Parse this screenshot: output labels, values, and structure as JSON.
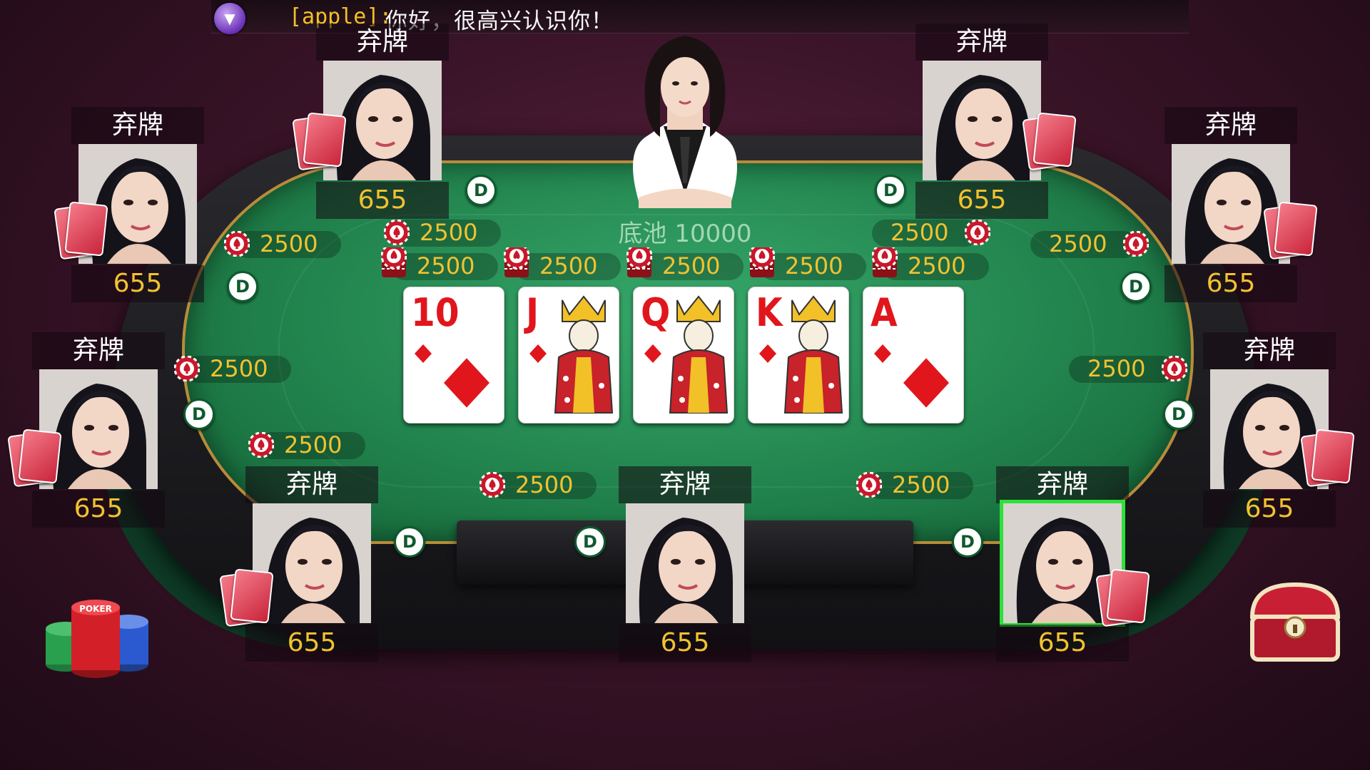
{
  "chat": {
    "sender": "[apple]:",
    "message": "你好，很高兴认识你！",
    "toggle_icon": "▼"
  },
  "pot": {
    "label": "底池 10000"
  },
  "community_cards": [
    {
      "rank": "10",
      "suit": "diamonds"
    },
    {
      "rank": "J",
      "suit": "diamonds"
    },
    {
      "rank": "Q",
      "suit": "diamonds"
    },
    {
      "rank": "K",
      "suit": "diamonds"
    },
    {
      "rank": "A",
      "suit": "diamonds"
    }
  ],
  "seats": [
    {
      "status": "弃牌",
      "chips": "655",
      "bet": "2500"
    },
    {
      "status": "弃牌",
      "chips": "655",
      "bet": "2500"
    },
    {
      "status": "弃牌",
      "chips": "655",
      "bet": "2500"
    },
    {
      "status": "弃牌",
      "chips": "655",
      "bet": "2500"
    },
    {
      "status": "弃牌",
      "chips": "655",
      "bet": "2500"
    },
    {
      "status": "弃牌",
      "chips": "655",
      "bet": "2500"
    },
    {
      "status": "弃牌",
      "chips": "655",
      "bet": "2500"
    },
    {
      "status": "弃牌",
      "chips": "655",
      "bet": "2500"
    },
    {
      "status": "弃牌",
      "chips": "655",
      "bet": "2500"
    }
  ],
  "center_bets": [
    "2500",
    "2500",
    "2500",
    "2500",
    "2500"
  ],
  "dealer_button_label": "D",
  "chip_stack_label": "POKER",
  "colors": {
    "felt": "#258a52",
    "chip_text": "#f2c230",
    "card_red": "#e0161c",
    "active_outline": "#2ee03a"
  }
}
